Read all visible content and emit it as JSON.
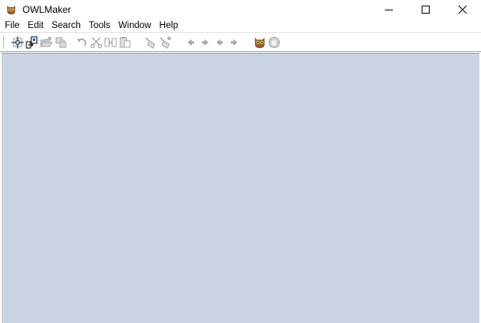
{
  "window": {
    "title": "OWLMaker",
    "app_icon": "owl-icon",
    "controls": [
      "minimize-icon",
      "maximize-icon",
      "close-icon"
    ]
  },
  "menubar": {
    "items": [
      {
        "label": "File"
      },
      {
        "label": "Edit"
      },
      {
        "label": "Search"
      },
      {
        "label": "Tools"
      },
      {
        "label": "Window"
      },
      {
        "label": "Help"
      }
    ]
  },
  "toolbar": {
    "buttons": [
      {
        "icon": "new-document-icon",
        "enabled": true
      },
      {
        "icon": "open-project-icon",
        "enabled": true
      },
      {
        "icon": "open-folder-icon",
        "enabled": false
      },
      {
        "icon": "save-icon",
        "enabled": false
      },
      {
        "icon": "undo-icon",
        "enabled": false
      },
      {
        "icon": "cut-icon",
        "enabled": false
      },
      {
        "icon": "copy-icon",
        "enabled": false
      },
      {
        "icon": "paste-icon",
        "enabled": false
      },
      {
        "icon": "find-icon",
        "enabled": false
      },
      {
        "icon": "find-next-icon",
        "enabled": false
      },
      {
        "icon": "back-icon",
        "enabled": false
      },
      {
        "icon": "forward-icon",
        "enabled": false
      },
      {
        "icon": "previous-icon",
        "enabled": false
      },
      {
        "icon": "next-icon",
        "enabled": false
      },
      {
        "icon": "owl-tool-icon",
        "enabled": true
      },
      {
        "icon": "stop-icon",
        "enabled": false
      }
    ]
  },
  "colors": {
    "client_background": "#c9d3e2",
    "disabled_icon": "#a6a6a6",
    "accent": "#1f5fbf"
  }
}
